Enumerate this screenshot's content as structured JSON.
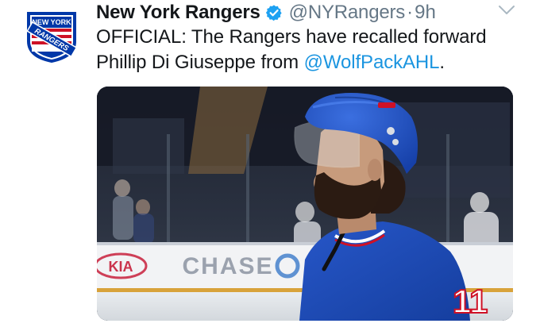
{
  "tweet": {
    "display_name": "New York Rangers",
    "handle": "@NYRangers",
    "separator": "·",
    "time": "9h",
    "text_before": "OFFICIAL: The Rangers have recalled forward Phillip Di Giuseppe from ",
    "mention": "@WolfPackAHL",
    "text_after": "."
  },
  "logo": {
    "line1": "NEW YORK",
    "line2": "RANGERS"
  },
  "media": {
    "board_text": "CHASE",
    "board_text_2": "KIA"
  },
  "icons": {
    "verified": "verified-badge-icon",
    "menu": "chevron-down-icon"
  },
  "colors": {
    "link": "#1b95e0",
    "muted": "#657786",
    "verified": "#1da1f2",
    "rangers_blue": "#0038a8",
    "rangers_red": "#ce1126"
  }
}
